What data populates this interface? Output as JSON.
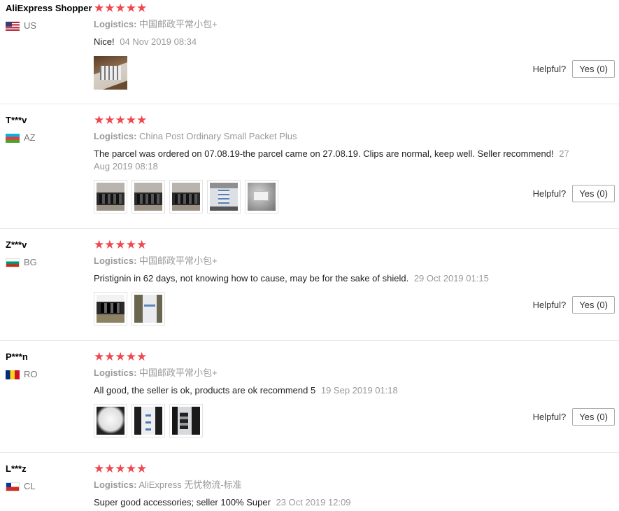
{
  "colors": {
    "star": "#f0474e",
    "muted": "#999999",
    "border": "#e8e8e8"
  },
  "reviews": [
    {
      "user": "AliExpress Shopper",
      "country": "US",
      "stars": "★★★★★",
      "rating": 5,
      "logistics_label": "Logistics:",
      "logistics": "中国邮政平常小包+",
      "text": "Nice!",
      "date": "04 Nov 2019 08:34",
      "helpful_label": "Helpful?",
      "yes_label": "Yes (0)"
    },
    {
      "user": "T***v",
      "country": "AZ",
      "stars": "★★★★★",
      "rating": 5,
      "logistics_label": "Logistics:",
      "logistics": "China Post Ordinary Small Packet Plus",
      "text": "The parcel was ordered on 07.08.19-the parcel came on 27.08.19. Clips are normal, keep well. Seller recommend!",
      "date": "27 Aug 2019 08:18",
      "helpful_label": "Helpful?",
      "yes_label": "Yes (0)"
    },
    {
      "user": "Z***v",
      "country": "BG",
      "stars": "★★★★★",
      "rating": 5,
      "logistics_label": "Logistics:",
      "logistics": "中国邮政平常小包+",
      "text": "Pristignin in 62 days, not knowing how to cause, may be for the sake of shield.",
      "date": "29 Oct 2019 01:15",
      "helpful_label": "Helpful?",
      "yes_label": "Yes (0)"
    },
    {
      "user": "P***n",
      "country": "RO",
      "stars": "★★★★★",
      "rating": 5,
      "logistics_label": "Logistics:",
      "logistics": "中国邮政平常小包+",
      "text": "All good, the seller is ok, products are ok recommend 5",
      "date": "19 Sep 2019 01:18",
      "helpful_label": "Helpful?",
      "yes_label": "Yes (0)"
    },
    {
      "user": "L***z",
      "country": "CL",
      "stars": "★★★★★",
      "rating": 5,
      "logistics_label": "Logistics:",
      "logistics": "AliExpress 无忧物流-标准",
      "text": "Super good accessories; seller 100% Super",
      "date": "23 Oct 2019 12:09"
    }
  ]
}
